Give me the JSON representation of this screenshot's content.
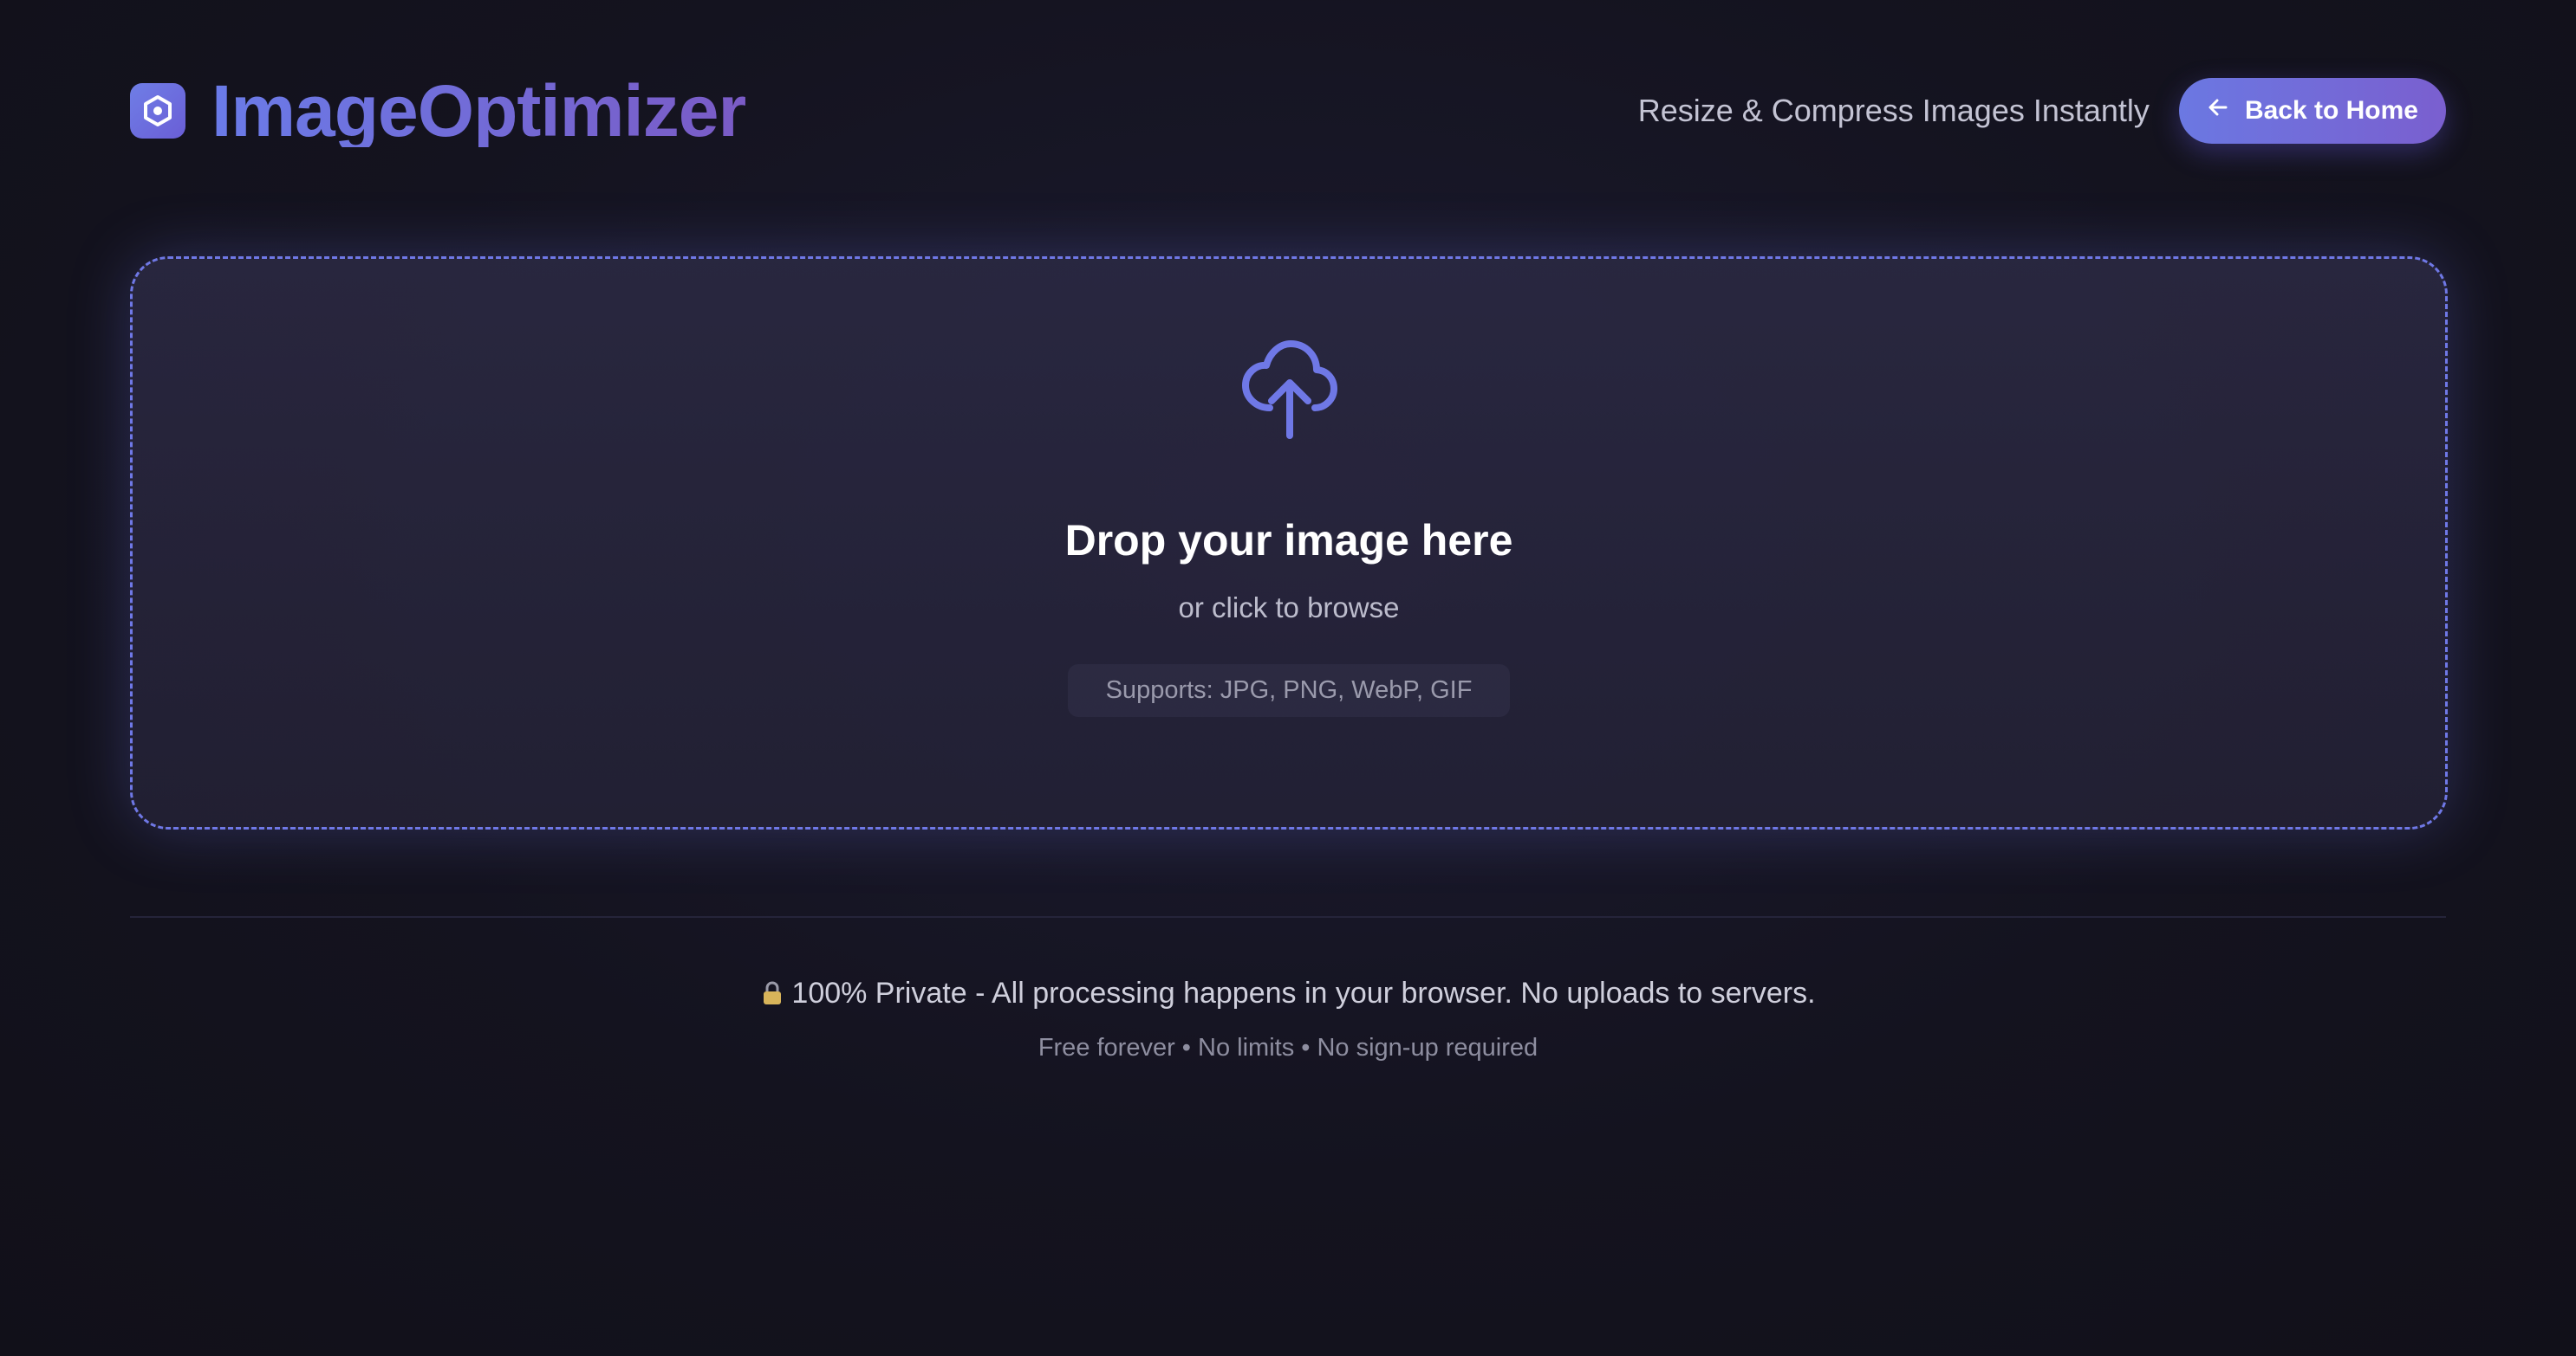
{
  "brand": {
    "name": "ImageOptimizer",
    "logo_icon": "hexagon-logo-icon"
  },
  "header": {
    "tagline": "Resize & Compress Images Instantly",
    "back_button_label": "Back to Home",
    "back_button_icon": "arrow-left-icon"
  },
  "dropzone": {
    "icon": "cloud-upload-icon",
    "title": "Drop your image here",
    "subtitle": "or click to browse",
    "supports": "Supports: JPG, PNG, WebP, GIF"
  },
  "footer": {
    "privacy_icon": "lock-icon",
    "privacy_text": "100% Private - All processing happens in your browser. No uploads to servers.",
    "footnote": "Free forever • No limits • No sign-up required"
  },
  "colors": {
    "accent": "#6f78e6",
    "accent_purple": "#7a5bc6",
    "background": "#14131f",
    "card": "#2a2840"
  }
}
